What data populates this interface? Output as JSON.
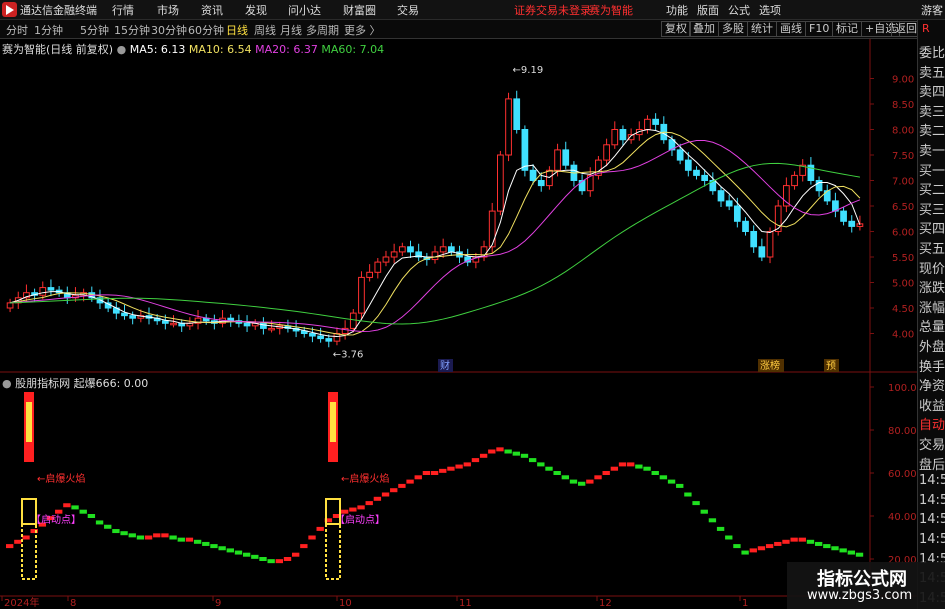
{
  "app": {
    "name": "通达信金融终端",
    "menu": [
      "行情",
      "市场",
      "资讯",
      "发现",
      "问小达",
      "财富圈",
      "交易"
    ],
    "notice": "证券交易未登录",
    "notice2": "赛为智能",
    "right_menu": [
      "功能",
      "版面",
      "公式",
      "选项"
    ],
    "guest": "游客"
  },
  "toolbar": {
    "periods": [
      "分时",
      "1分钟",
      "5分钟",
      "15分钟",
      "30分钟",
      "60分钟",
      "日线",
      "周线",
      "月线",
      "多周期",
      "更多 〉"
    ],
    "active_period": "日线",
    "actions": [
      "复权",
      "叠加",
      "多股",
      "统计",
      "画线",
      "F10",
      "标记",
      "+自选",
      "返回"
    ]
  },
  "side": {
    "mark": "R",
    "items": [
      "委比",
      "卖五",
      "卖四",
      "卖三",
      "卖二",
      "卖一",
      "买一",
      "买二",
      "买三",
      "买四",
      "买五",
      "现价",
      "涨跌",
      "涨幅",
      "总量",
      "外盘",
      "换手",
      "净资",
      "收益",
      "自动",
      "交易",
      "盘后",
      "14:56",
      "14:56",
      "14:56",
      "14:56",
      "14:56",
      "14:56",
      "14:56"
    ]
  },
  "main_panel": {
    "title": "赛为智能(日线 前复权)",
    "ma": [
      {
        "label": "MA5: 6.13",
        "color": "#ffffff"
      },
      {
        "label": "MA10: 6.54",
        "color": "#f0e060"
      },
      {
        "label": "MA20: 6.37",
        "color": "#e040e0"
      },
      {
        "label": "MA60: 7.04",
        "color": "#40d040"
      }
    ],
    "high_label": "9.19",
    "low_label": "3.76",
    "event_labels": [
      "财",
      "涨榜",
      "预"
    ]
  },
  "sub_panel": {
    "title": "股朋指标网",
    "value_label": "起爆666: 0.00",
    "annotations": [
      "启爆火焰",
      "启动点"
    ]
  },
  "watermark": {
    "title": "指标公式网",
    "url": "www.zbgs3.com"
  },
  "chart_data": [
    {
      "type": "candlestick",
      "title": "赛为智能(日线 前复权)",
      "ylim": [
        3.5,
        9.5
      ],
      "yticks": [
        "9.00",
        "8.50",
        "8.00",
        "7.50",
        "7.00",
        "6.50",
        "6.00",
        "5.50",
        "5.00",
        "4.50",
        "4.00"
      ],
      "x_labels": [
        "2024年",
        "8",
        "9",
        "10",
        "11",
        "12",
        "1"
      ],
      "high": 9.19,
      "low": 3.76,
      "close_path": [
        4.6,
        4.7,
        4.8,
        4.75,
        4.9,
        4.85,
        4.8,
        4.7,
        4.75,
        4.8,
        4.7,
        4.6,
        4.5,
        4.4,
        4.35,
        4.3,
        4.35,
        4.3,
        4.25,
        4.2,
        4.2,
        4.15,
        4.2,
        4.3,
        4.25,
        4.2,
        4.3,
        4.25,
        4.2,
        4.15,
        4.2,
        4.1,
        4.1,
        4.15,
        4.1,
        4.05,
        4.0,
        3.95,
        3.9,
        3.85,
        4.0,
        4.1,
        4.4,
        5.1,
        5.2,
        5.4,
        5.5,
        5.6,
        5.7,
        5.6,
        5.5,
        5.45,
        5.6,
        5.7,
        5.6,
        5.5,
        5.4,
        5.5,
        5.7,
        6.4,
        7.5,
        8.6,
        8.0,
        7.2,
        7.0,
        6.9,
        7.2,
        7.6,
        7.3,
        7.0,
        6.8,
        7.1,
        7.4,
        7.7,
        8.0,
        7.8,
        7.9,
        8.0,
        8.2,
        8.1,
        7.8,
        7.6,
        7.4,
        7.2,
        7.1,
        7.0,
        6.8,
        6.6,
        6.5,
        6.2,
        6.0,
        5.7,
        5.5,
        6.0,
        6.5,
        6.9,
        7.1,
        7.3,
        7.0,
        6.8,
        6.6,
        6.4,
        6.2,
        6.1,
        6.15
      ],
      "ma5_series": [
        4.6,
        4.65,
        4.72,
        4.76,
        4.8,
        4.82,
        4.82,
        4.78,
        4.76,
        4.76,
        4.72,
        4.66,
        4.58,
        4.5,
        4.42,
        4.37,
        4.34,
        4.32,
        4.3,
        4.26,
        4.24,
        4.2,
        4.2,
        4.22,
        4.22,
        4.22,
        4.24,
        4.24,
        4.24,
        4.22,
        4.2,
        4.17,
        4.15,
        4.13,
        4.11,
        4.09,
        4.06,
        4.02,
        3.98,
        3.95,
        3.94,
        3.96,
        4.04,
        4.28,
        4.56,
        4.84,
        5.12,
        5.36,
        5.48,
        5.5,
        5.52,
        5.5,
        5.5,
        5.55,
        5.6,
        5.57,
        5.52,
        5.5,
        5.52,
        5.74,
        6.18,
        6.8,
        7.2,
        7.28,
        7.3,
        7.1,
        7.06,
        7.18,
        7.2,
        7.2,
        7.14,
        7.12,
        7.18,
        7.3,
        7.48,
        7.68,
        7.88,
        7.96,
        8.0,
        7.98,
        7.92,
        7.82,
        7.66,
        7.5,
        7.36,
        7.2,
        7.04,
        6.88,
        6.74,
        6.56,
        6.38,
        6.18,
        6.0,
        5.98,
        6.06,
        6.24,
        6.48,
        6.7,
        6.86,
        6.96,
        6.96,
        6.9,
        6.74,
        6.54,
        6.13
      ]
    },
    {
      "type": "line",
      "title": "股朋指标网",
      "series_name": "起爆666",
      "ylim": [
        20,
        100
      ],
      "yticks": [
        "100.0",
        "80.00",
        "60.00",
        "40.00",
        "20.00"
      ],
      "values": [
        26,
        28,
        30,
        33,
        36,
        39,
        42,
        45,
        44,
        42,
        40,
        37,
        35,
        33,
        32,
        31,
        30,
        30,
        31,
        31,
        30,
        29,
        29,
        28,
        27,
        26,
        25,
        24,
        23,
        22,
        21,
        20,
        19,
        19,
        20,
        22,
        26,
        30,
        34,
        38,
        40,
        42,
        43,
        44,
        46,
        48,
        50,
        52,
        54,
        56,
        58,
        60,
        60,
        61,
        62,
        63,
        64,
        66,
        68,
        70,
        71,
        70,
        69,
        68,
        66,
        64,
        62,
        60,
        58,
        56,
        55,
        56,
        58,
        60,
        62,
        64,
        64,
        63,
        62,
        60,
        58,
        56,
        54,
        50,
        46,
        42,
        38,
        34,
        30,
        26,
        23,
        24,
        25,
        26,
        27,
        28,
        29,
        29,
        28,
        27,
        26,
        25,
        24,
        23,
        22
      ],
      "trigger_indices": [
        0,
        38
      ]
    }
  ]
}
